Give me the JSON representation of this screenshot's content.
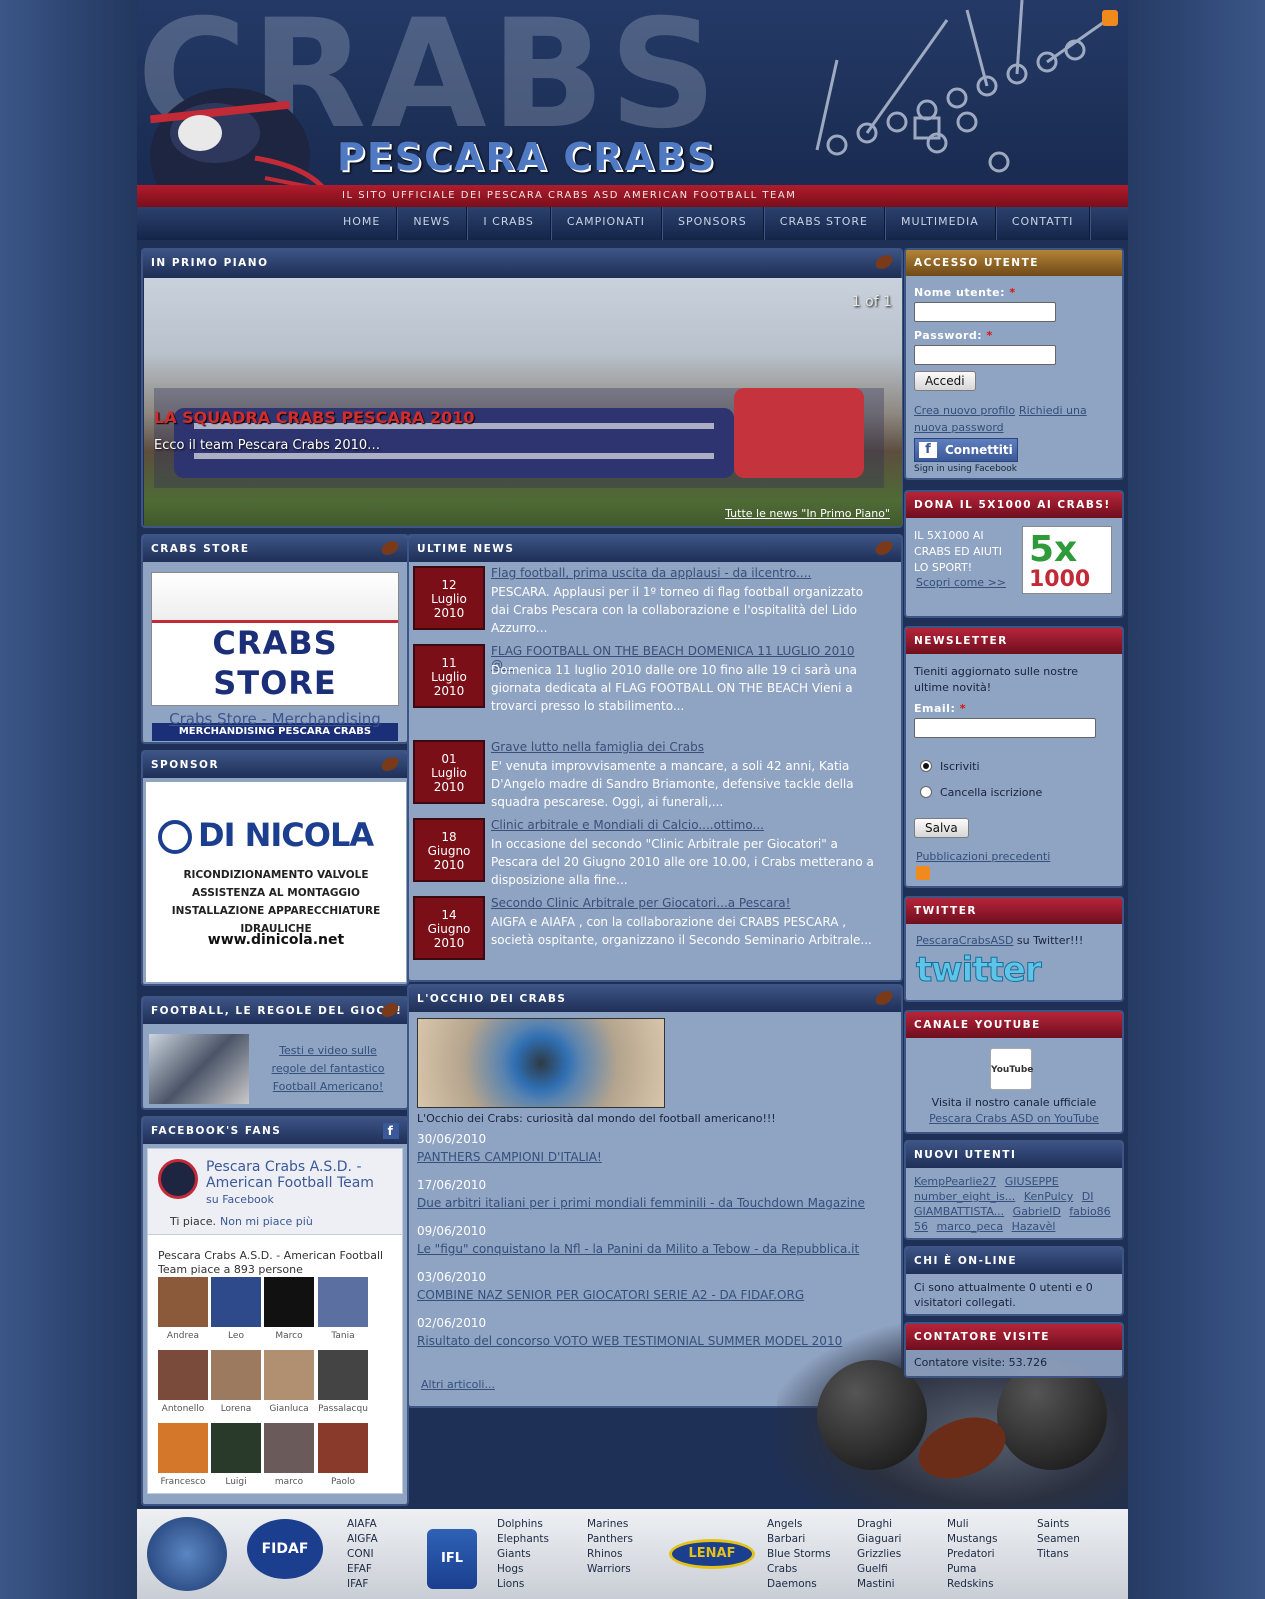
{
  "header": {
    "big_text": "CRABS",
    "title": "PESCARA CRABS",
    "tagline": "IL SITO UFFICIALE DEI PESCARA CRABS ASD AMERICAN FOOTBALL TEAM",
    "nav": [
      "HOME",
      "NEWS",
      "I CRABS",
      "CAMPIONATI",
      "SPONSORS",
      "CRABS STORE",
      "MULTIMEDIA",
      "CONTATTI"
    ]
  },
  "in_primo_piano": {
    "heading": "IN PRIMO PIANO",
    "counter": "1 of 1",
    "title": "LA SQUADRA CRABS PESCARA 2010",
    "subtitle": "Ecco il team Pescara Crabs 2010…",
    "all_link": "Tutte le news \"In Primo Piano\""
  },
  "crabs_store": {
    "heading": "CRABS STORE",
    "logo_text": "CRABS STORE",
    "logo_sub": "MERCHANDISING PESCARA CRABS",
    "link": "Crabs Store - Merchandising"
  },
  "sponsor": {
    "heading": "SPONSOR",
    "name": "DI NICOLA",
    "lines": [
      "RICONDIZIONAMENTO VALVOLE",
      "ASSISTENZA AL MONTAGGIO",
      "INSTALLAZIONE APPARECCHIATURE IDRAULICHE"
    ],
    "url": "www.dinicola.net"
  },
  "regole": {
    "heading": "FOOTBALL, LE REGOLE DEL GIOCO!",
    "text": "Testi e video sulle regole del fantastico Football Americano!"
  },
  "facebook": {
    "heading": "FACEBOOK'S FANS",
    "page_name": "Pescara Crabs A.S.D. - American Football Team",
    "on_fb": "su Facebook",
    "like": "Ti piace.",
    "unlike": "Non mi piace più",
    "count_text": "Pescara Crabs A.S.D. - American Football Team piace a 893 persone",
    "fans": [
      "Andrea",
      "Leo",
      "Marco",
      "Tania",
      "Antonello",
      "Lorena",
      "Gianluca",
      "Passalacqu",
      "Francesco",
      "Luigi",
      "marco",
      "Paolo"
    ]
  },
  "ultime_news": {
    "heading": "ULTIME NEWS",
    "items": [
      {
        "d": "12",
        "m": "Luglio",
        "y": "2010",
        "title": "Flag football, prima uscita da applausi - da ilcentro....",
        "text": " PESCARA. Applausi per il 1º torneo di flag football organizzato dai Crabs Pescara con la collaborazione e l'ospitalità del Lido Azzurro..."
      },
      {
        "d": "11",
        "m": "Luglio",
        "y": "2010",
        "title": "FLAG FOOTBALL ON THE BEACH DOMENICA 11 LUGLIO 2010 @...",
        "text": "Domenica 11 luglio 2010 dalle ore 10 fino alle 19 ci sarà una giornata dedicata al FLAG FOOTBALL ON THE BEACH Vieni a trovarci presso lo stabilimento..."
      },
      {
        "d": "01",
        "m": "Luglio",
        "y": "2010",
        "title": "Grave lutto nella famiglia dei Crabs",
        "text": "E' venuta improvvisamente a mancare, a soli 42 anni, Katia D'Angelo madre di Sandro Briamonte, defensive tackle della squadra pescarese. Oggi, ai funerali,..."
      },
      {
        "d": "18",
        "m": "Giugno",
        "y": "2010",
        "title": "Clinic arbitrale e Mondiali di Calcio....ottimo...",
        "text": "In occasione del secondo \"Clinic Arbitrale per Giocatori\" a Pescara del 20 Giugno 2010 alle ore 10.00, i Crabs metterano a disposizione alla fine..."
      },
      {
        "d": "14",
        "m": "Giugno",
        "y": "2010",
        "title": "Secondo Clinic Arbitrale per Giocatori...a Pescara!",
        "text": "AIGFA e AIAFA , con la collaborazione dei CRABS PESCARA , società ospitante, organizzano il Secondo Seminario Arbitrale..."
      }
    ]
  },
  "occhio": {
    "heading": "L'OCCHIO DEI CRABS",
    "caption": "L'Occhio dei Crabs: curiosità dal mondo del football americano!!!",
    "items": [
      {
        "date": "30/06/2010",
        "title": "PANTHERS CAMPIONI D'ITALIA!"
      },
      {
        "date": "17/06/2010",
        "title": "Due arbitri italiani per i primi mondiali femminili - da Touchdown Magazine"
      },
      {
        "date": "09/06/2010",
        "title": "Le \"figu\" conquistano la Nfl - la Panini da Milito a Tebow - da Repubblica.it"
      },
      {
        "date": "03/06/2010",
        "title": "COMBINE NAZ SENIOR PER GIOCATORI SERIE A2 - DA FIDAF.ORG"
      },
      {
        "date": "02/06/2010",
        "title": "Risultato del concorso VOTO WEB TESTIMONIAL SUMMER MODEL 2010"
      }
    ],
    "more": "Altri articoli..."
  },
  "login": {
    "heading": "ACCESSO UTENTE",
    "user_label": "Nome utente:",
    "pass_label": "Password:",
    "submit": "Accedi",
    "create": "Crea nuovo profilo",
    "request": "Richiedi una nuova password",
    "fb_button": "Connettiti",
    "fb_sub": "Sign in using Facebook"
  },
  "dona": {
    "heading": "DONA IL 5X1000 AI CRABS!",
    "text": "IL 5X1000 AI CRABS ED AIUTI LO SPORT!",
    "link": "Scopri come >>",
    "logo_a": "5x",
    "logo_b": "1000"
  },
  "newsletter": {
    "heading": "NEWSLETTER",
    "intro": "Tieniti aggiornato sulle nostre ultime novità!",
    "email_label": "Email:",
    "opt1": "Iscriviti",
    "opt2": "Cancella iscrizione",
    "submit": "Salva",
    "previous": "Pubblicazioni precedenti"
  },
  "twitter": {
    "heading": "TWITTER",
    "account": "PescaraCrabsASD",
    "suffix": " su Twitter!!!",
    "logo": "twitter"
  },
  "youtube": {
    "heading": "CANALE YOUTUBE",
    "logo": "YouTube",
    "text": "Visita il nostro canale ufficiale",
    "link": "Pescara Crabs ASD on YouTube"
  },
  "nuovi_utenti": {
    "heading": "NUOVI UTENTI",
    "users": [
      "KempPearlie27",
      "GIUSEPPE",
      "number_eight_is...",
      "KenPulcy",
      "DI GIAMBATTISTA...",
      "GabrielD",
      "fabio86",
      "56",
      "marco_peca",
      "Hazavèl"
    ]
  },
  "online": {
    "heading": "CHI È ON-LINE",
    "text": "Ci sono attualmente 0 utenti e 0 visitatori collegati."
  },
  "contatore": {
    "heading": "CONTATORE VISITE",
    "text": "Contatore visite: 53.726"
  },
  "footer": {
    "col1": [
      "AIAFA",
      "AIGFA",
      "CONI",
      "EFAF",
      "IFAF"
    ],
    "col2": [
      "Dolphins",
      "Elephants",
      "Giants",
      "Hogs",
      "Lions"
    ],
    "col3": [
      "Marines",
      "Panthers",
      "Rhinos",
      "Warriors"
    ],
    "col4": [
      "Angels",
      "Barbari",
      "Blue Storms",
      "Crabs",
      "Daemons"
    ],
    "col5": [
      "Draghi",
      "Giaguari",
      "Grizzlies",
      "Guelfi",
      "Mastini"
    ],
    "col6": [
      "Muli",
      "Mustangs",
      "Predatori",
      "Puma",
      "Redskins"
    ],
    "col7": [
      "Saints",
      "Seamen",
      "Titans"
    ],
    "logo_fidaf": "FIDAF",
    "logo_ifl": "IFL",
    "logo_lenaf": "LENAF"
  },
  "colors": {
    "accent_red": "#b01c2c",
    "nav_dark": "#1a2c52",
    "panel": "#8fa3c2"
  }
}
